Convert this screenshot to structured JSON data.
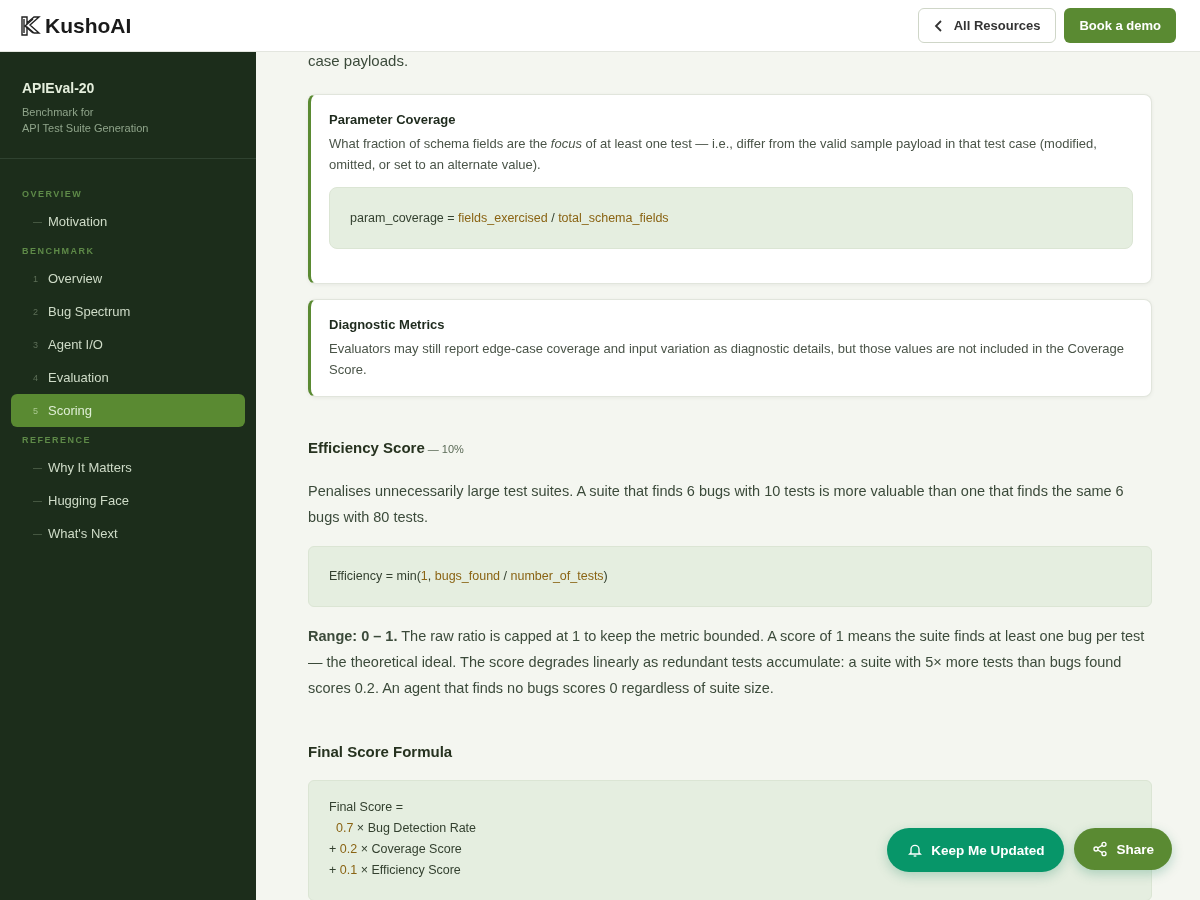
{
  "header": {
    "logo_text": "KushoAI",
    "buttons": [
      {
        "label": "All Resources",
        "kind": "outline"
      },
      {
        "label": "Book a demo",
        "kind": "primary"
      }
    ]
  },
  "sidebar": {
    "title": "APIEval-20",
    "subtitle_lines": [
      "Benchmark for",
      "API Test Suite Generation"
    ],
    "sections": [
      {
        "heading": "OVERVIEW",
        "items": [
          {
            "marker": "—",
            "label": "Motivation",
            "selected": false
          }
        ]
      },
      {
        "heading": "BENCHMARK",
        "items": [
          {
            "marker": "1",
            "label": "Overview",
            "selected": false
          },
          {
            "marker": "2",
            "label": "Bug Spectrum",
            "selected": false
          },
          {
            "marker": "3",
            "label": "Agent I/O",
            "selected": false
          },
          {
            "marker": "4",
            "label": "Evaluation",
            "selected": false
          },
          {
            "marker": "5",
            "label": "Scoring",
            "selected": true
          }
        ]
      },
      {
        "heading": "REFERENCE",
        "items": [
          {
            "marker": "—",
            "label": "Why It Matters",
            "selected": false
          },
          {
            "marker": "—",
            "label": "Hugging Face",
            "selected": false
          },
          {
            "marker": "—",
            "label": "What's Next",
            "selected": false
          }
        ]
      }
    ]
  },
  "main": {
    "intro_tail": "case payloads.",
    "cards": [
      {
        "title": "Parameter Coverage",
        "body": "What fraction of schema fields are the *focus* of at least one test — i.e., differ from the valid sample payload in that test case (modified, omitted, or set to an alternate value).",
        "code_lines": [
          [
            {
              "text": "param_coverage = ",
              "kind": "plain"
            },
            {
              "text": "fields_exercised",
              "kind": "var"
            },
            {
              "text": " / ",
              "kind": "plain"
            },
            {
              "text": "total_schema_fields",
              "kind": "var"
            }
          ]
        ]
      },
      {
        "title": "Diagnostic Metrics",
        "body": "Evaluators may still report edge-case coverage and input variation as diagnostic details, but those values are not included in the Coverage Score."
      }
    ],
    "sections": [
      {
        "heading": "Efficiency Score",
        "weight": "— 10%",
        "paragraph": "Penalises unnecessarily large test suites. A suite that finds 6 bugs with 10 tests is more valuable than one that finds the same 6 bugs with 80 tests.",
        "code_lines": [
          [
            {
              "text": "Efficiency = min(",
              "kind": "plain"
            },
            {
              "text": "1",
              "kind": "var"
            },
            {
              "text": ", ",
              "kind": "plain"
            },
            {
              "text": "bugs_found",
              "kind": "var"
            },
            {
              "text": " / ",
              "kind": "plain"
            },
            {
              "text": "number_of_tests",
              "kind": "var"
            },
            {
              "text": ")",
              "kind": "plain"
            }
          ]
        ],
        "after": "**Range: 0 – 1.** The raw ratio is capped at 1 to keep the metric bounded. A score of 1 means the suite finds at least one bug per test — the theoretical ideal. The score degrades linearly as redundant tests accumulate: a suite with 5× more tests than bugs found scores 0.2. An agent that finds no bugs scores 0 regardless of suite size."
      },
      {
        "heading": "Final Score Formula",
        "code_lines": [
          [
            {
              "text": "Final Score =",
              "kind": "plain"
            }
          ],
          [
            {
              "text": "0.7",
              "kind": "var"
            },
            {
              "text": " × Bug Detection Rate",
              "kind": "plain"
            }
          ],
          [
            {
              "text": "+ ",
              "kind": "plain"
            },
            {
              "text": "0.2",
              "kind": "var"
            },
            {
              "text": " × Coverage Score",
              "kind": "plain"
            }
          ],
          [
            {
              "text": "+ ",
              "kind": "plain"
            },
            {
              "text": "0.1",
              "kind": "var"
            },
            {
              "text": " × Efficiency Score",
              "kind": "plain"
            }
          ]
        ]
      }
    ]
  },
  "floating_buttons": [
    {
      "label": "Keep Me Updated",
      "kind": "bell"
    },
    {
      "label": "Share",
      "kind": "share"
    }
  ]
}
